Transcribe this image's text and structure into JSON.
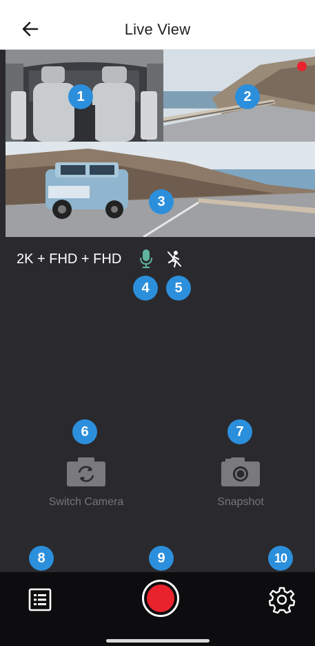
{
  "header": {
    "title": "Live View",
    "back_icon": "arrow-left-icon"
  },
  "cameras": [
    {
      "badge": "1",
      "view": "interior"
    },
    {
      "badge": "2",
      "view": "rear road",
      "recording_indicator_color": "#e8232e"
    },
    {
      "badge": "3",
      "view": "front road"
    }
  ],
  "status": {
    "resolution": "2K + FHD + FHD",
    "mic_badge": "4",
    "motion_badge": "5",
    "mic_icon": "microphone-icon",
    "motion_icon": "motion-detection-off-icon"
  },
  "actions": {
    "switch_camera": {
      "badge": "6",
      "label": "Switch Camera",
      "icon": "switch-camera-icon"
    },
    "snapshot": {
      "badge": "7",
      "label": "Snapshot",
      "icon": "camera-icon"
    }
  },
  "bottom_bar": {
    "list_badge": "8",
    "record_badge": "9",
    "settings_badge": "10",
    "list_icon": "list-icon",
    "record_icon": "record-icon",
    "settings_icon": "gear-icon"
  },
  "colors": {
    "badge": "#2c8fdc",
    "record": "#e8232e",
    "background": "#2a2a2e",
    "bottom_bar": "#0d0d0f",
    "mic": "#5fb3a0"
  }
}
